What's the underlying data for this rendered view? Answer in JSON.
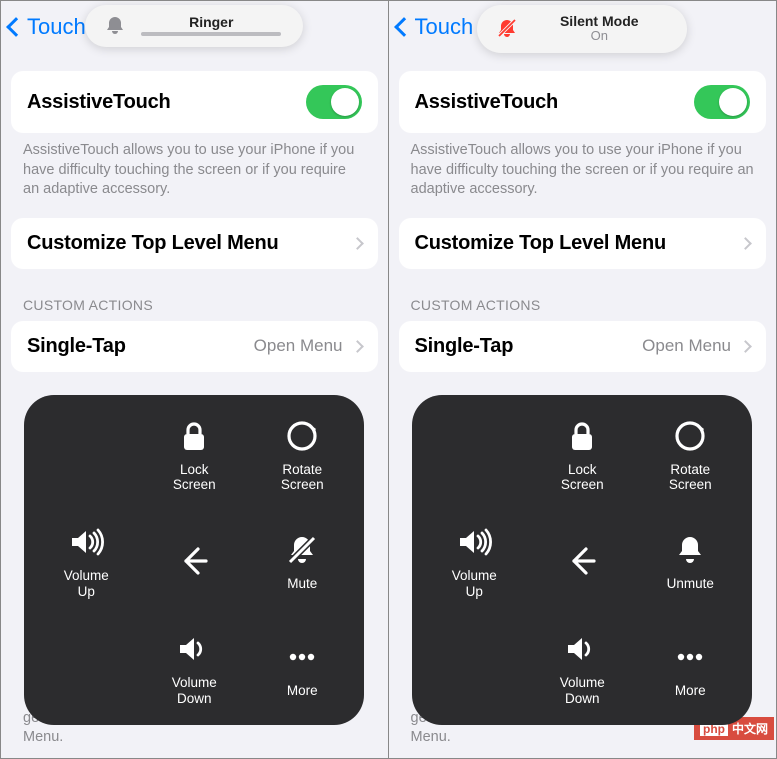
{
  "left": {
    "back": "Touch",
    "toast": {
      "title": "Ringer",
      "has_slider": true,
      "icon": "bell"
    },
    "assistive": {
      "label": "AssistiveTouch",
      "on": true
    },
    "desc": "AssistiveTouch allows you to use your iPhone if you have difficulty touching the screen or if you require an adaptive accessory.",
    "customize": "Customize Top Level Menu",
    "section": "CUSTOM ACTIONS",
    "single_tap": {
      "label": "Single-Tap",
      "value": "Open Menu"
    },
    "overlay": {
      "lock": "Lock\nScreen",
      "rotate": "Rotate\nScreen",
      "vol_up": "Volume\nUp",
      "mute": "Mute",
      "vol_down": "Volume\nDown",
      "more": "More"
    },
    "tail": "gestures that can be activated from Custom in the Menu."
  },
  "right": {
    "back": "Touch",
    "toast": {
      "title": "Silent Mode",
      "sub": "On",
      "icon": "bell-slash-red"
    },
    "assistive": {
      "label": "AssistiveTouch",
      "on": true
    },
    "desc": "AssistiveTouch allows you to use your iPhone if you have difficulty touching the screen or if you require an adaptive accessory.",
    "customize": "Customize Top Level Menu",
    "section": "CUSTOM ACTIONS",
    "single_tap": {
      "label": "Single-Tap",
      "value": "Open Menu"
    },
    "overlay": {
      "lock": "Lock\nScreen",
      "rotate": "Rotate\nScreen",
      "vol_up": "Volume\nUp",
      "unmute": "Unmute",
      "vol_down": "Volume\nDown",
      "more": "More"
    },
    "tail": "gestures that can be activated from Custom in the Menu."
  },
  "watermark": {
    "a": "php",
    "b": "中文网"
  }
}
